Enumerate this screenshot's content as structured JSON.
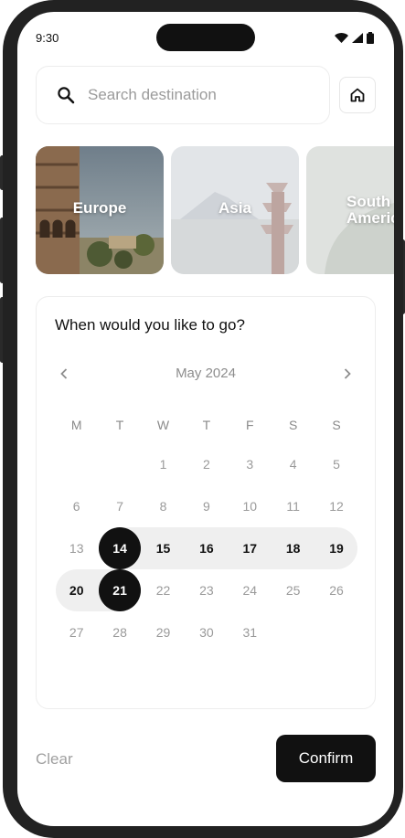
{
  "status_bar": {
    "time": "9:30"
  },
  "search": {
    "placeholder": "Search destination"
  },
  "destinations": [
    {
      "label": "Europe"
    },
    {
      "label": "Asia"
    },
    {
      "label": "South\nAmeric"
    }
  ],
  "calendar": {
    "title": "When would you like to go?",
    "month": "May 2024",
    "weekdays": [
      "M",
      "T",
      "W",
      "T",
      "F",
      "S",
      "S"
    ],
    "weeks": [
      [
        "",
        "",
        "1",
        "2",
        "3",
        "4",
        "5"
      ],
      [
        "6",
        "7",
        "8",
        "9",
        "10",
        "11",
        "12"
      ],
      [
        "13",
        "14",
        "15",
        "16",
        "17",
        "18",
        "19"
      ],
      [
        "20",
        "21",
        "22",
        "23",
        "24",
        "25",
        "26"
      ],
      [
        "27",
        "28",
        "29",
        "30",
        "31",
        "",
        ""
      ]
    ],
    "range_start": "14",
    "range_end": "21"
  },
  "actions": {
    "clear": "Clear",
    "confirm": "Confirm"
  },
  "colors": {
    "accent": "#111111",
    "range": "#efefef",
    "muted": "#9a9a9a"
  }
}
